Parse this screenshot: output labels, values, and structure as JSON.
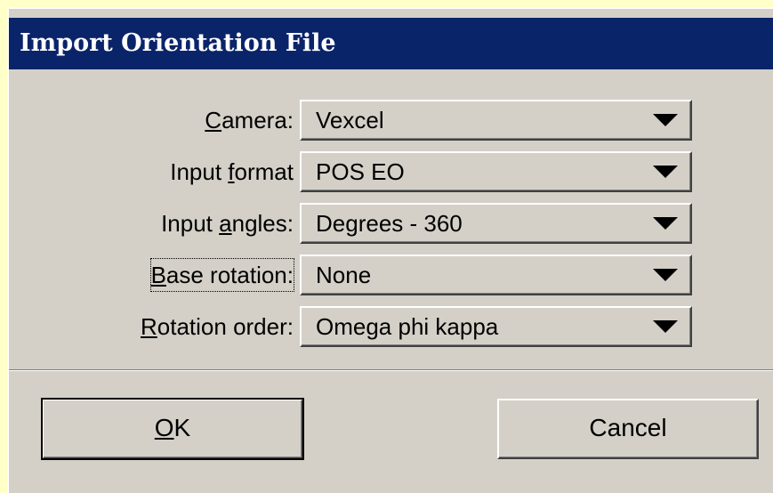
{
  "dialog": {
    "title": "Import Orientation File"
  },
  "fields": [
    {
      "label_pre": "",
      "label_key": "C",
      "label_post": "amera:",
      "value": "Vexcel"
    },
    {
      "label_pre": "Input ",
      "label_key": "f",
      "label_post": "ormat",
      "value": "POS EO"
    },
    {
      "label_pre": "Input ",
      "label_key": "a",
      "label_post": "ngles:",
      "value": "Degrees - 360"
    },
    {
      "label_pre": "",
      "label_key": "B",
      "label_post": "ase rotation:",
      "value": "None"
    },
    {
      "label_pre": "",
      "label_key": "R",
      "label_post": "otation order:",
      "value": "Omega phi kappa"
    }
  ],
  "buttons": {
    "ok_key": "O",
    "ok_rest": "K",
    "cancel": "Cancel"
  },
  "colors": {
    "titlebar": "#0a246a",
    "dialog_face": "#d4d0c8",
    "page_background": "#ffffc8"
  },
  "icons": {
    "dropdown": "chevron-down-icon"
  }
}
